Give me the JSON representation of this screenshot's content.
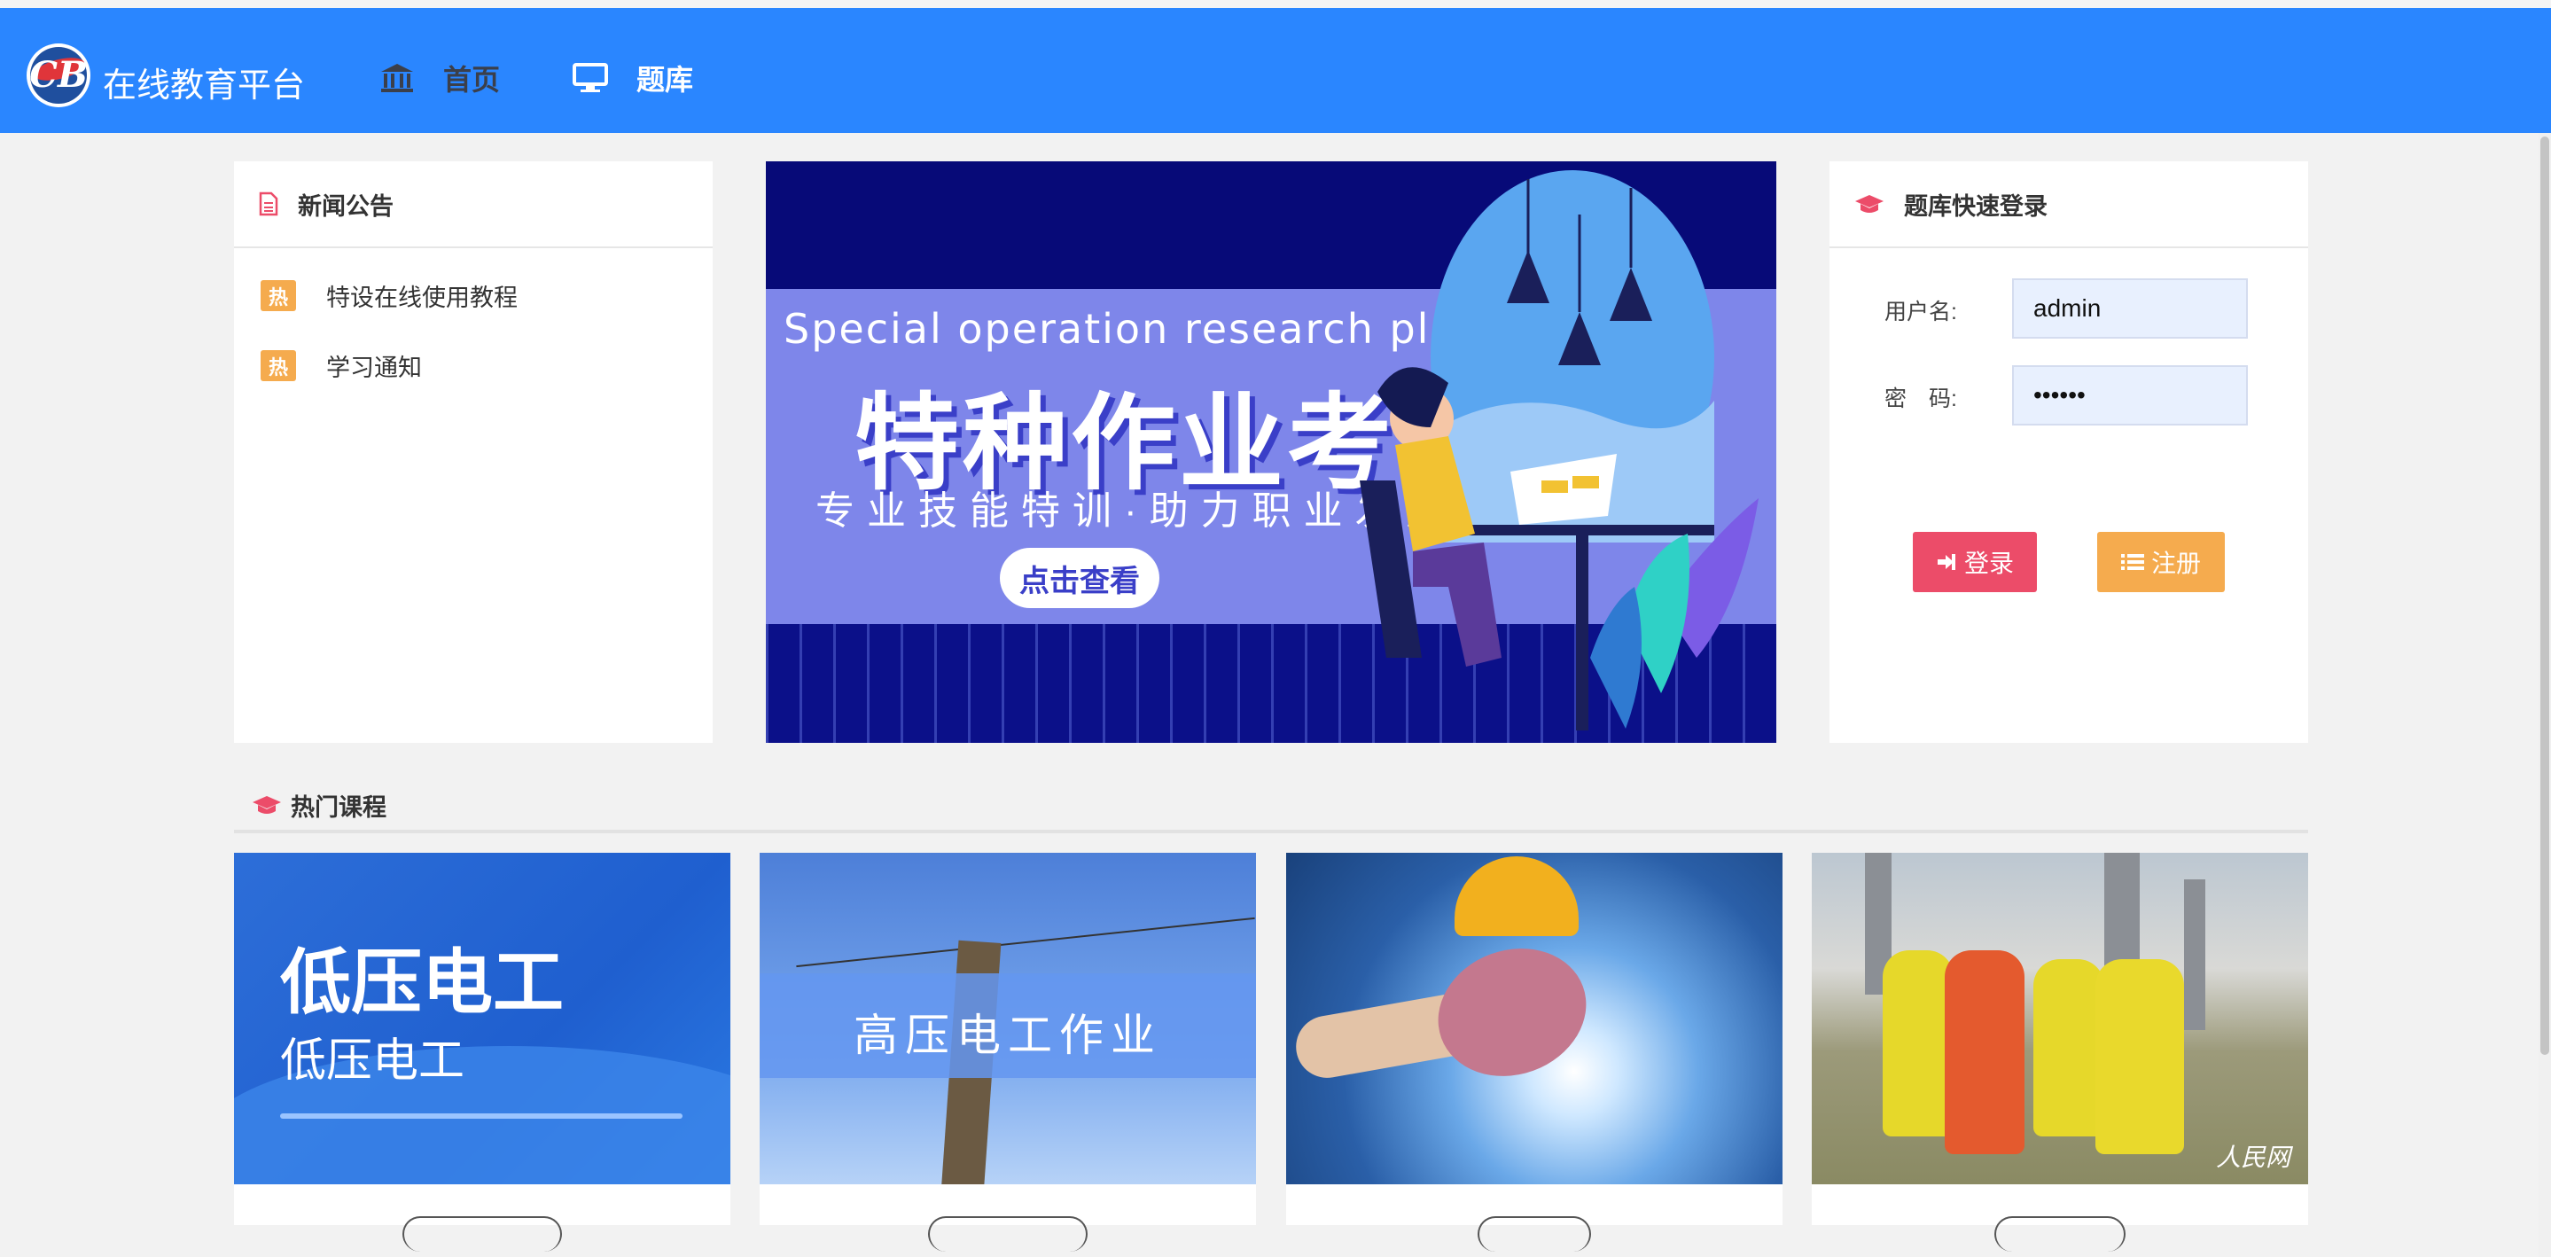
{
  "nav": {
    "brand": "在线教育平台",
    "logo_text": "CB",
    "home": "首页",
    "question_bank": "题库"
  },
  "news": {
    "title": "新闻公告",
    "items": [
      {
        "badge": "热",
        "text": "特设在线使用教程"
      },
      {
        "badge": "热",
        "text": "学习通知"
      }
    ]
  },
  "banner": {
    "english": "Special operation research platform",
    "title": "特种作业考证",
    "subtitle": "专业技能特训·助力职业发展",
    "button": "点击查看"
  },
  "login": {
    "title": "题库快速登录",
    "username_label": "用户名:",
    "username_value": "admin",
    "password_label": "密　码:",
    "password_value": "••••••",
    "login_button": "登录",
    "register_button": "注册"
  },
  "courses": {
    "title": "热门课程",
    "items": [
      {
        "img_title": "低压电工",
        "img_sub": "低压电工"
      },
      {
        "img_title": "高压电工作业"
      },
      {},
      {
        "watermark": "人民网"
      }
    ]
  },
  "colors": {
    "navbar": "#2a86ff",
    "accent_red": "#ec4c69",
    "accent_orange": "#f5ab4e"
  }
}
